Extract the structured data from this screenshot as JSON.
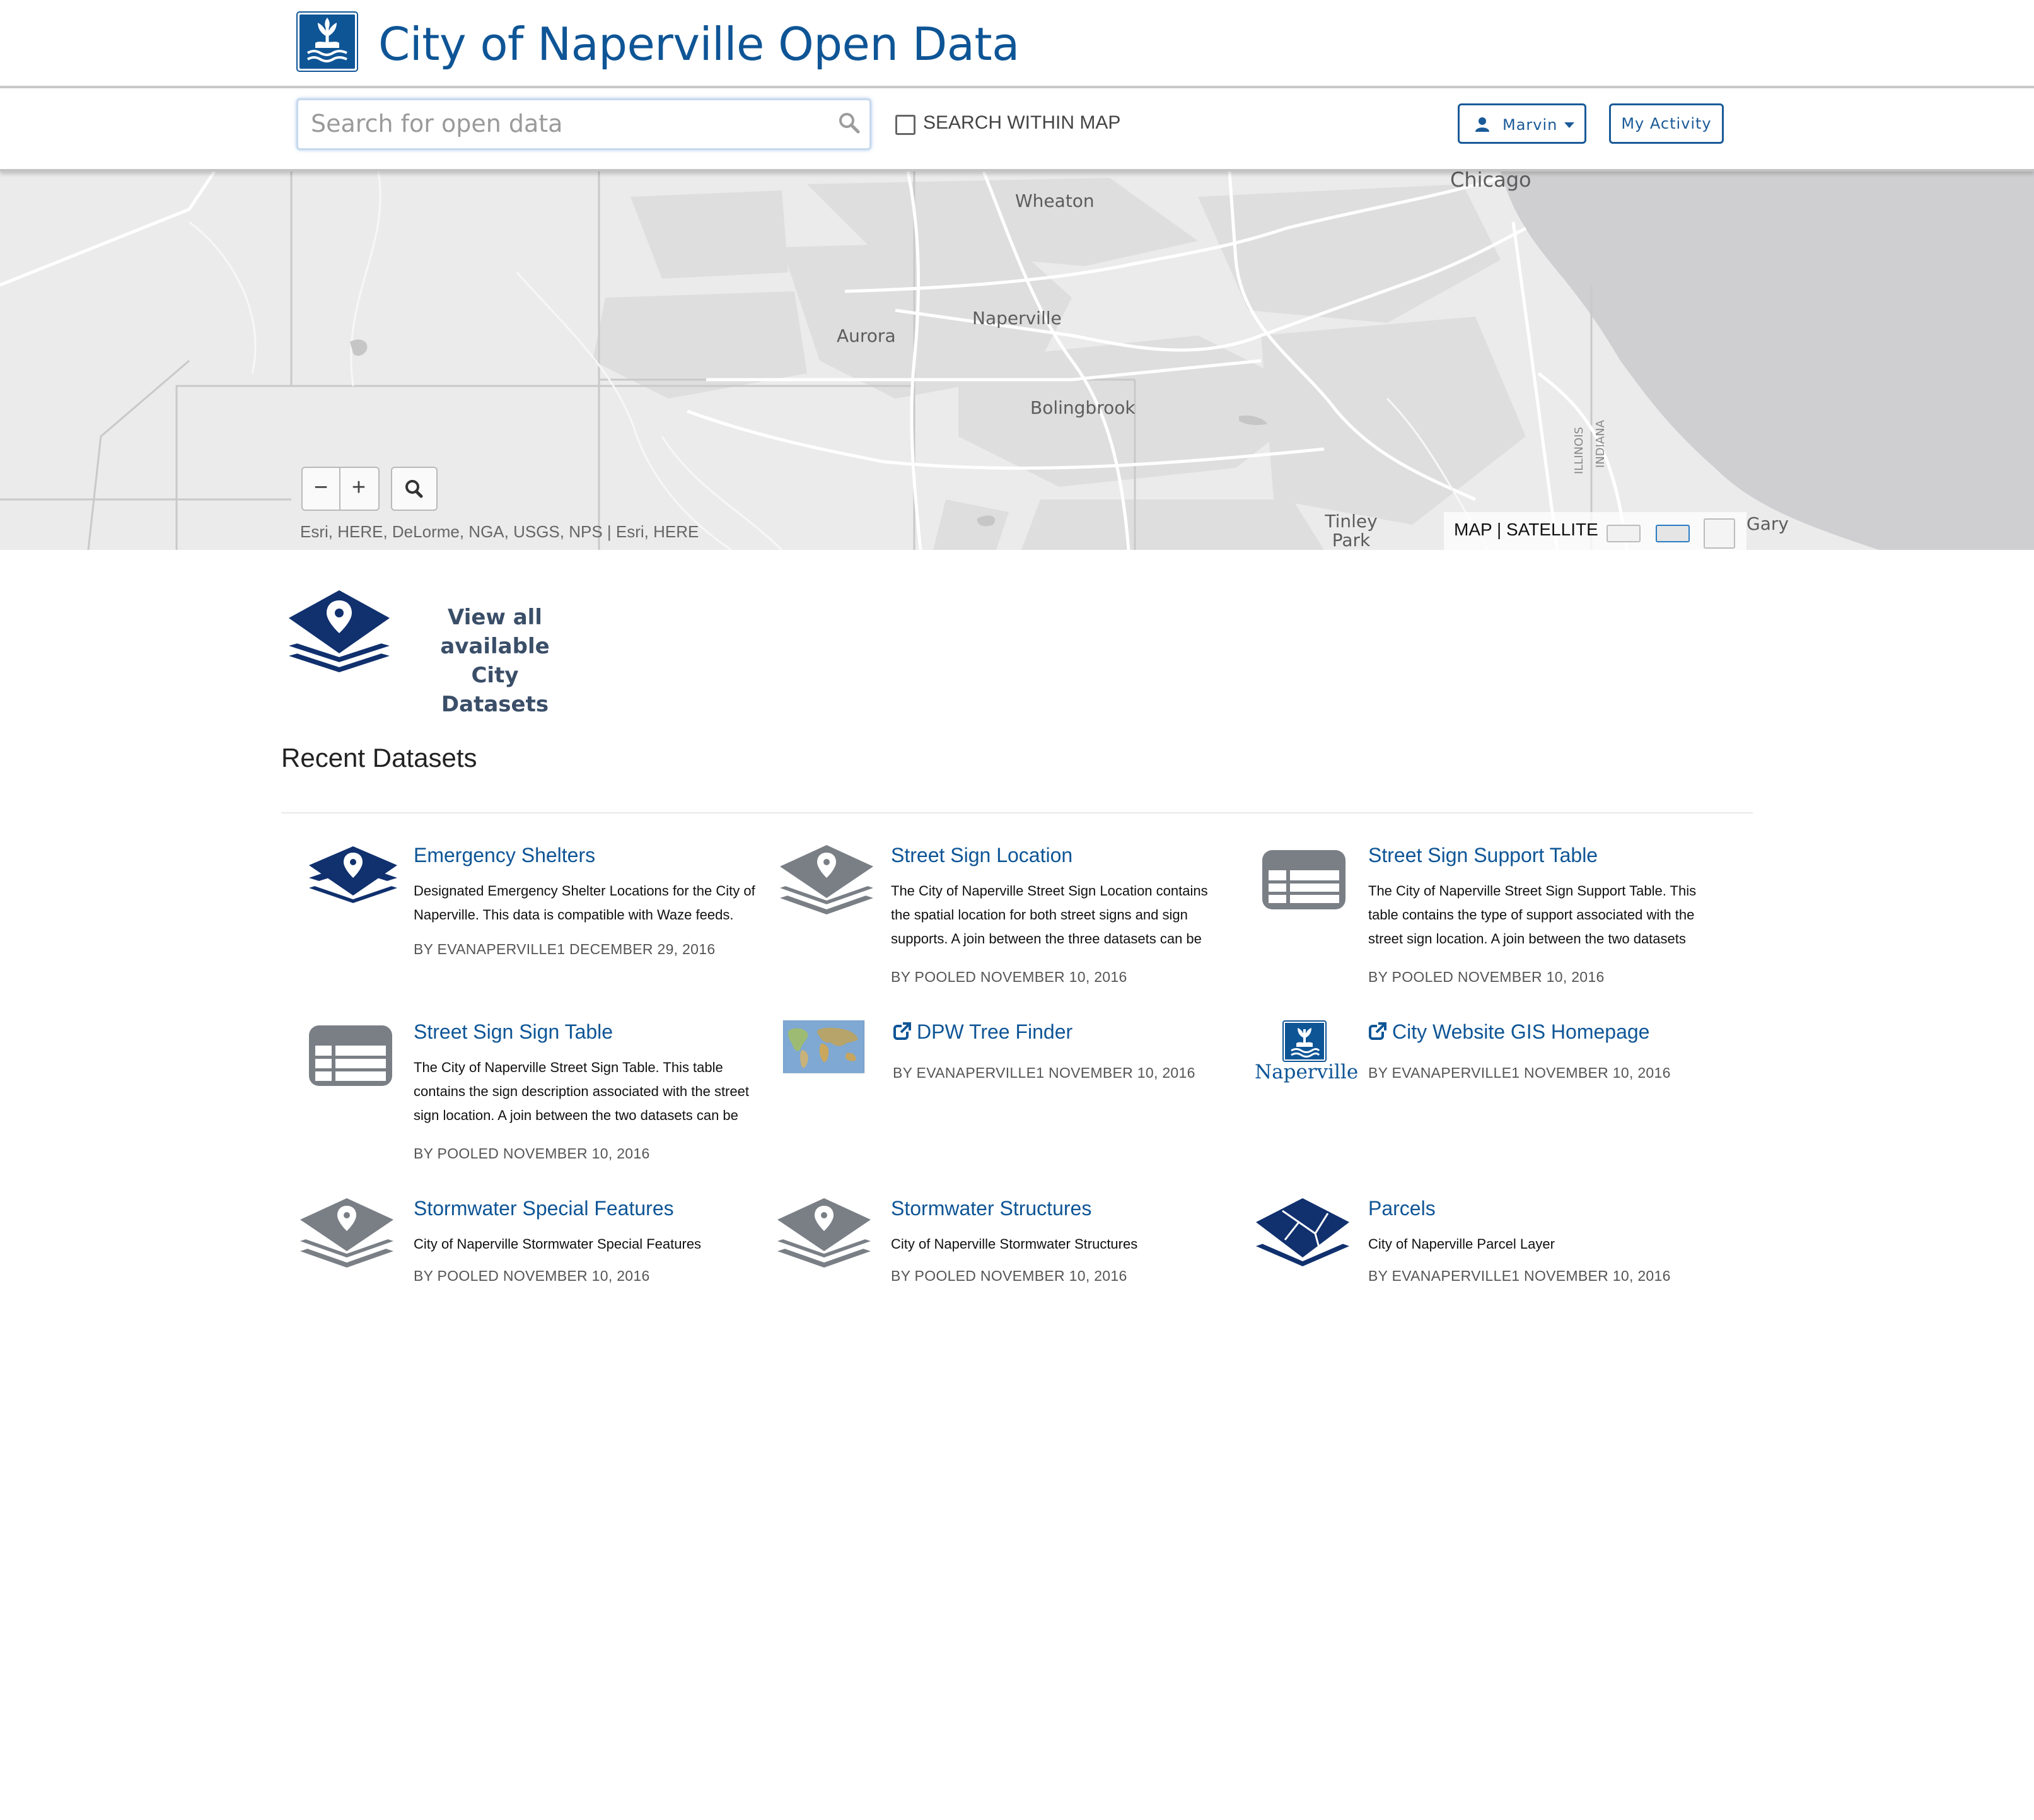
{
  "header": {
    "site_title": "City of Naperville Open Data"
  },
  "toolbar": {
    "search_placeholder": "Search for open data",
    "search_within_map_label": "SEARCH WITHIN MAP",
    "user_label": "Marvin",
    "my_activity_label": "My Activity"
  },
  "map": {
    "cities": [
      "Chicago",
      "Wheaton",
      "Naperville",
      "Aurora",
      "Bolingbrook",
      "Tinley Park",
      "Gary"
    ],
    "state_labels": [
      "ILLINOIS",
      "INDIANA"
    ],
    "zoom_out_label": "−",
    "zoom_in_label": "+",
    "attribution": "Esri, HERE, DeLorme, NGA, USGS, NPS | Esri, HERE",
    "basemap_label": "MAP | SATELLITE"
  },
  "view_all": {
    "line1": "View all available",
    "line2": "City Datasets"
  },
  "recent": {
    "title": "Recent Datasets",
    "datasets": [
      {
        "title": "Emergency Shelters",
        "description": "Designated Emergency Shelter Locations for the City of Naperville. This data is compatible with Waze feeds.",
        "meta": "BY EVANAPERVILLE1 DECEMBER 29, 2016",
        "icon": "layers-pin-icon"
      },
      {
        "title": "Street Sign Location",
        "description": "The City of Naperville Street Sign Location contains the spatial location for both street signs and sign supports.  A join between the three datasets can be",
        "meta": "BY POOLED NOVEMBER 10, 2016",
        "icon": "layers-pin-icon"
      },
      {
        "title": "Street Sign Support Table",
        "description": "The City of Naperville Street Sign Support Table.  This table contains the type of support associated with the street sign location.  A join between the two datasets",
        "meta": "BY POOLED NOVEMBER 10, 2016",
        "icon": "table-icon"
      },
      {
        "title": "Street Sign Sign Table",
        "description": "The City of Naperville Street Sign Table.  This table contains the sign description associated with the street sign location.  A join between the two datasets can be",
        "meta": "BY POOLED NOVEMBER 10, 2016",
        "icon": "table-icon"
      },
      {
        "title": "DPW Tree Finder",
        "description": "",
        "meta": "BY EVANAPERVILLE1 NOVEMBER 10, 2016",
        "icon": "world-map-thumbnail"
      },
      {
        "title": "City Website GIS Homepage",
        "description": "",
        "meta": "BY EVANAPERVILLE1 NOVEMBER 10, 2016",
        "icon": "naperville-logo",
        "logo_text": "Naperville"
      },
      {
        "title": "Stormwater Special Features",
        "description": "City of Naperville Stormwater Special Features",
        "meta": "BY POOLED NOVEMBER 10, 2016",
        "icon": "layers-pin-icon"
      },
      {
        "title": "Stormwater Structures",
        "description": "City of Naperville Stormwater Structures",
        "meta": "BY POOLED NOVEMBER 10, 2016",
        "icon": "layers-pin-icon"
      },
      {
        "title": "Parcels",
        "description": "City of Naperville Parcel Layer",
        "meta": "BY EVANAPERVILLE1 NOVEMBER 10, 2016",
        "icon": "parcels-icon"
      }
    ]
  },
  "colors": {
    "brand_blue": "#0e5596",
    "dark_navy": "#10306e",
    "icon_gray": "#7a7f86"
  }
}
